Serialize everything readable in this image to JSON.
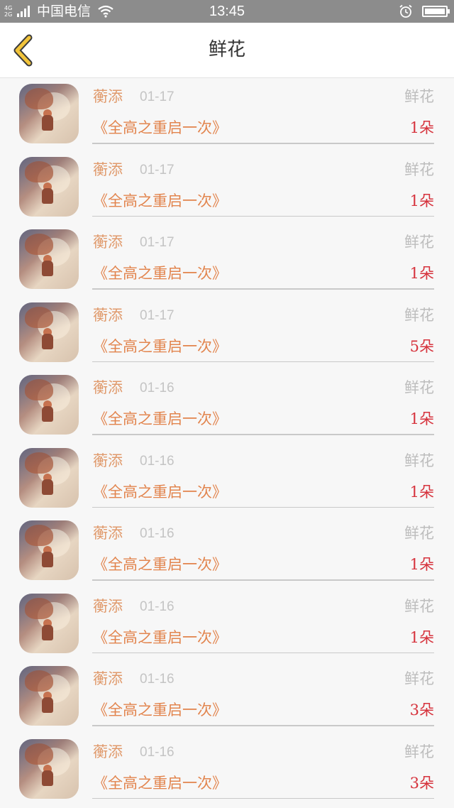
{
  "status_bar": {
    "network_top": "4G",
    "network_bottom": "2G",
    "carrier": "中国电信",
    "time": "13:45",
    "icons": [
      "signal-icon",
      "wifi-icon",
      "alarm-icon",
      "battery-icon"
    ]
  },
  "nav": {
    "title": "鲜花",
    "back_icon": "chevron-left-icon",
    "accent_color": "#f2c43a"
  },
  "colors": {
    "user": "#e09a6c",
    "date": "#c4c4c4",
    "type": "#bdbdbd",
    "book": "#e2844d",
    "count": "#d6323c"
  },
  "records": [
    {
      "user": "蘅添",
      "date": "01-17",
      "type": "鲜花",
      "book": "《全高之重启一次》",
      "count": "1朵"
    },
    {
      "user": "蘅添",
      "date": "01-17",
      "type": "鲜花",
      "book": "《全高之重启一次》",
      "count": "1朵"
    },
    {
      "user": "蘅添",
      "date": "01-17",
      "type": "鲜花",
      "book": "《全高之重启一次》",
      "count": "1朵"
    },
    {
      "user": "蘅添",
      "date": "01-17",
      "type": "鲜花",
      "book": "《全高之重启一次》",
      "count": "5朵"
    },
    {
      "user": "蘅添",
      "date": "01-16",
      "type": "鲜花",
      "book": "《全高之重启一次》",
      "count": "1朵"
    },
    {
      "user": "蘅添",
      "date": "01-16",
      "type": "鲜花",
      "book": "《全高之重启一次》",
      "count": "1朵"
    },
    {
      "user": "蘅添",
      "date": "01-16",
      "type": "鲜花",
      "book": "《全高之重启一次》",
      "count": "1朵"
    },
    {
      "user": "蘅添",
      "date": "01-16",
      "type": "鲜花",
      "book": "《全高之重启一次》",
      "count": "1朵"
    },
    {
      "user": "蘅添",
      "date": "01-16",
      "type": "鲜花",
      "book": "《全高之重启一次》",
      "count": "3朵"
    },
    {
      "user": "蘅添",
      "date": "01-16",
      "type": "鲜花",
      "book": "《全高之重启一次》",
      "count": "3朵"
    }
  ]
}
